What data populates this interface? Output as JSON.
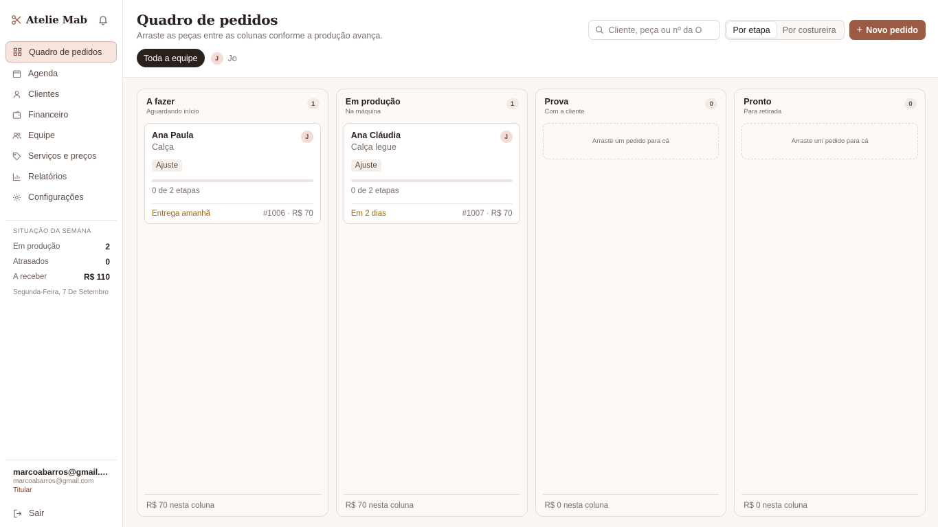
{
  "app": {
    "name": "Atelie Mab"
  },
  "nav": [
    {
      "label": "Quadro de pedidos",
      "icon": "grid-icon",
      "active": true
    },
    {
      "label": "Agenda",
      "icon": "calendar-icon",
      "active": false
    },
    {
      "label": "Clientes",
      "icon": "user-icon",
      "active": false
    },
    {
      "label": "Financeiro",
      "icon": "wallet-icon",
      "active": false
    },
    {
      "label": "Equipe",
      "icon": "users-icon",
      "active": false
    },
    {
      "label": "Serviços e preços",
      "icon": "tag-icon",
      "active": false
    },
    {
      "label": "Relatórios",
      "icon": "bar-chart-icon",
      "active": false
    },
    {
      "label": "Configurações",
      "icon": "gear-icon",
      "active": false
    }
  ],
  "week": {
    "title": "Situação da semana",
    "rows": [
      {
        "label": "Em produção",
        "value": "2"
      },
      {
        "label": "Atrasados",
        "value": "0"
      },
      {
        "label": "A receber",
        "value": "R$ 110"
      }
    ],
    "date": "Segunda-Feira, 7 De Setembro"
  },
  "user": {
    "name": "marcoabarros@gmail.com",
    "email": "marcoabarros@gmail.com",
    "role": "Titular"
  },
  "logout_label": "Sair",
  "header": {
    "title": "Quadro de pedidos",
    "subtitle": "Arraste as peças entre as colunas conforme a produção avança.",
    "team_filter": "Toda a equipe",
    "member": {
      "initial": "J",
      "name": "Jo"
    },
    "search_placeholder": "Cliente, peça ou nº da O",
    "view_options": [
      "Por etapa",
      "Por costureira"
    ],
    "view_selected": "Por etapa",
    "new_order_label": "Novo pedido"
  },
  "columns": [
    {
      "title": "A fazer",
      "subtitle": "Aguardando início",
      "count": "1",
      "footer": "R$ 70 nesta coluna",
      "cards": [
        {
          "client": "Ana Paula",
          "item": "Calça",
          "avatar": "J",
          "tag": "Ajuste",
          "steps": "0 de 2 etapas",
          "progress": 0,
          "due": "Entrega amanhã",
          "meta": "#1006 · R$ 70"
        }
      ]
    },
    {
      "title": "Em produção",
      "subtitle": "Na máquina",
      "count": "1",
      "footer": "R$ 70 nesta coluna",
      "cards": [
        {
          "client": "Ana Cláudia",
          "item": "Calça legue",
          "avatar": "J",
          "tag": "Ajuste",
          "steps": "0 de 2 etapas",
          "progress": 0,
          "due": "Em 2 dias",
          "meta": "#1007 · R$ 70"
        }
      ]
    },
    {
      "title": "Prova",
      "subtitle": "Com a cliente",
      "count": "0",
      "footer": "R$ 0 nesta coluna",
      "empty_text": "Arraste um pedido para cá",
      "cards": []
    },
    {
      "title": "Pronto",
      "subtitle": "Para retirada",
      "count": "0",
      "footer": "R$ 0 nesta coluna",
      "empty_text": "Arraste um pedido para cá",
      "cards": []
    }
  ],
  "colors": {
    "accent": "#9a5a44",
    "active_nav_bg": "#f6e4df",
    "due_text": "#9a6b18",
    "dark_chip": "#2a211d"
  }
}
